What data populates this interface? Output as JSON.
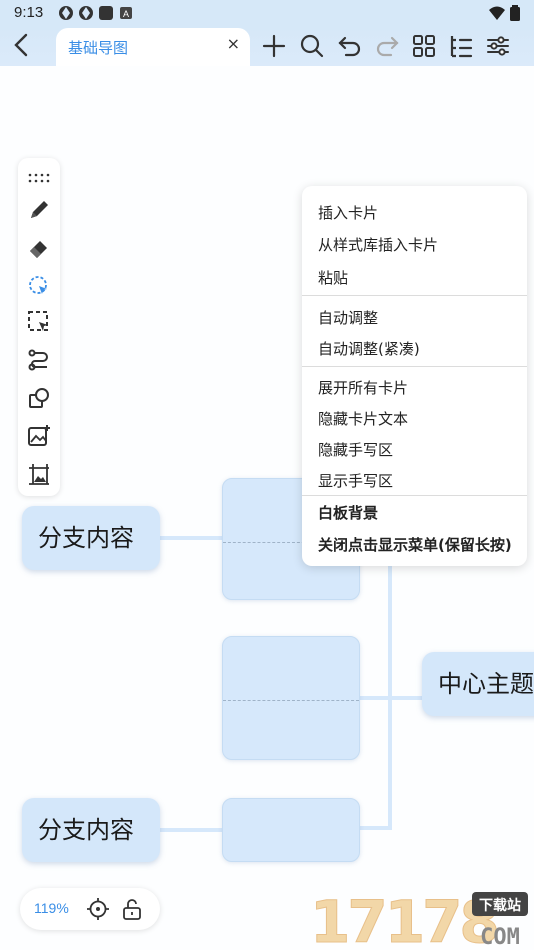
{
  "status_bar": {
    "time": "9:13",
    "icons": [
      "app-icon",
      "app-icon",
      "notification-icon",
      "a-icon"
    ],
    "right_icons": [
      "wifi-icon",
      "battery-icon"
    ]
  },
  "header": {
    "tab_title": "基础导图",
    "close_glyph": "×",
    "toolbar_icons": [
      "add-icon",
      "search-icon",
      "undo-icon",
      "redo-icon",
      "grid-icon",
      "outline-icon",
      "settings-sliders-icon"
    ]
  },
  "left_tools": [
    "drag-handle-icon",
    "pen-icon",
    "eraser-icon",
    "lasso-icon",
    "select-rect-icon",
    "connector-icon",
    "shapes-icon",
    "image-add-icon",
    "image-frame-icon"
  ],
  "mindmap": {
    "branch_top": "分支内容",
    "branch_bottom": "分支内容",
    "center": "中心主题"
  },
  "context_menu": {
    "items": [
      "插入卡片",
      "从样式库插入卡片",
      "粘贴",
      "自动调整",
      "自动调整(紧凑)",
      "展开所有卡片",
      "隐藏卡片文本",
      "隐藏手写区",
      "显示手写区",
      "白板背景",
      "关闭点击显示菜单(保留长按)"
    ]
  },
  "zoom": {
    "value": "119%"
  },
  "watermark": {
    "number": "17178",
    "badge": "下载站",
    "domain": "COM"
  },
  "colors": {
    "accent": "#3a8ee6",
    "node": "#d4e7fa",
    "topbar": "#d6e8f8"
  }
}
